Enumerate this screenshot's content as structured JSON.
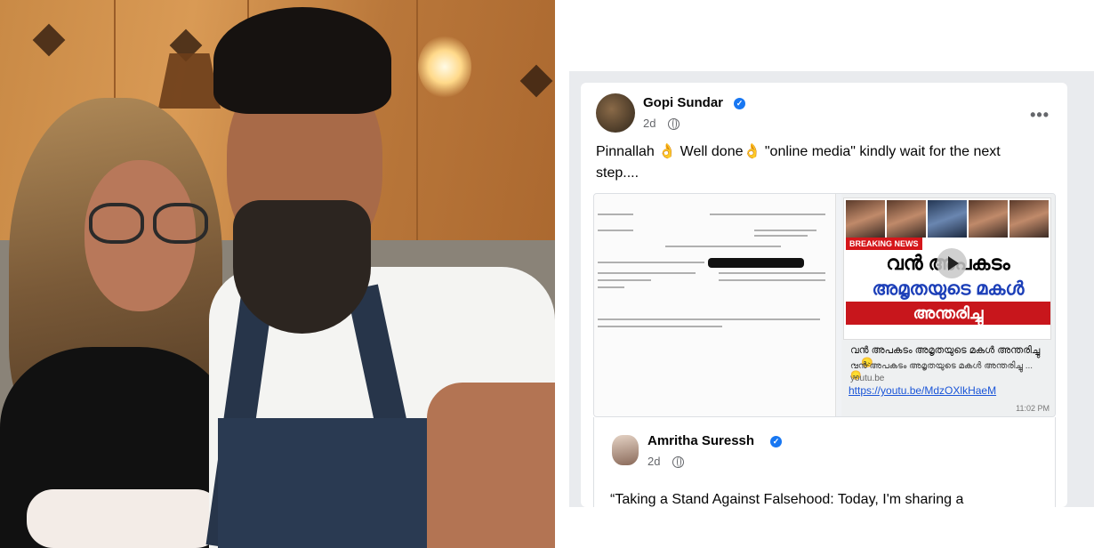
{
  "post": {
    "author": "Gopi Sundar",
    "time": "2d",
    "more": "•••",
    "text": "Pinnallah 👌 Well done👌 \"online media\" kindly wait for the next step....",
    "chat": {
      "breaking": "BREAKING NEWS",
      "headline_line1": "വൻ അപകടം",
      "headline_line2": "അമൃതയുടെ മകൾ",
      "headline_line3": "അന്തരിച്ചു",
      "title": "വൻ അപകടം അമൃതയുടെ മകൾ അന്തരിച്ചു ... 😞",
      "subtitle": "വൻ അപകടം അമൃതയുടെ മകൾ അന്തരിച്ചു ... 😞",
      "domain": "youtu.be",
      "link": "https://youtu.be/MdzOXlkHaeM",
      "timestamp": "11:02 PM"
    }
  },
  "shared": {
    "author": "Amritha Suressh",
    "time": "2d",
    "text": "“Taking a Stand Against Falsehood: Today, I'm sharing a"
  },
  "colors": {
    "verified": "#1877f2",
    "link": "#1a55d8",
    "breaking_red": "#d5161a"
  },
  "icons": {
    "verified": "check-badge",
    "audience": "globe",
    "video": "play"
  }
}
